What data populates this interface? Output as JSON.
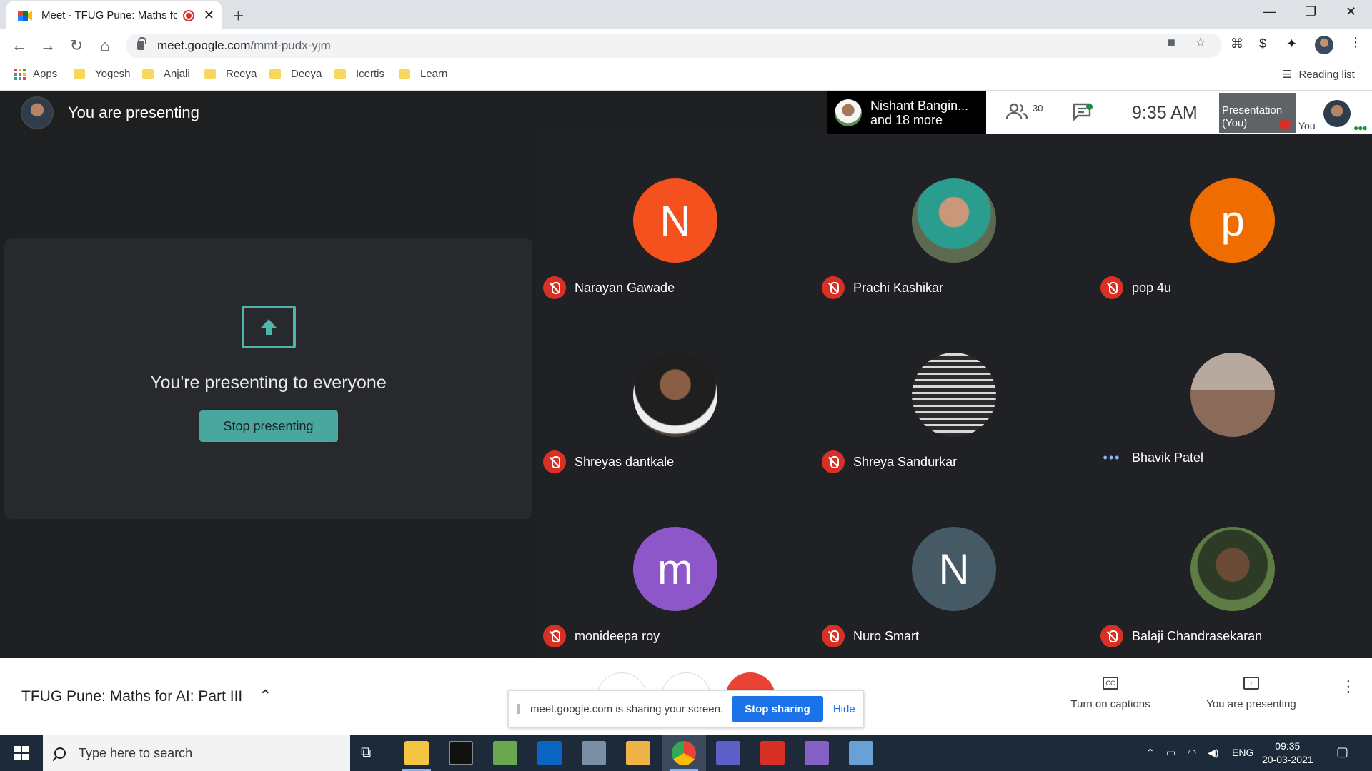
{
  "browser": {
    "tab_title": "Meet - TFUG Pune: Maths for AI: Part III",
    "url_host": "meet.google.com",
    "url_path": "/mmf-pudx-yjm",
    "new_tab_symbol": "+",
    "bookmarks": [
      {
        "label": "Apps",
        "icon": "apps-grid-icon"
      },
      {
        "label": "Yogesh",
        "icon": "folder-icon"
      },
      {
        "label": "Anjali",
        "icon": "folder-icon"
      },
      {
        "label": "Reeya",
        "icon": "folder-icon"
      },
      {
        "label": "Deeya",
        "icon": "folder-icon"
      },
      {
        "label": "Icertis",
        "icon": "folder-icon"
      },
      {
        "label": "Learn",
        "icon": "folder-icon"
      }
    ],
    "reading_list": "Reading list"
  },
  "meet": {
    "banner": "You are presenting",
    "presenting_card": {
      "message": "You're presenting to everyone",
      "stop_button": "Stop presenting"
    },
    "speaker_chip": {
      "line1": "Nishant Bangin...",
      "line2": "and 18 more"
    },
    "people_count": "30",
    "time": "9:35 AM",
    "presentation_thumb": {
      "line1": "Presentation",
      "line2": "(You)"
    },
    "you_label": "You",
    "participants": [
      {
        "name": "Narayan Gawade",
        "initial": "N",
        "color": "#f4511e",
        "status": "muted"
      },
      {
        "name": "Prachi Kashikar",
        "initial": "",
        "color": "#6b8f8a",
        "status": "muted"
      },
      {
        "name": "pop 4u",
        "initial": "p",
        "color": "#ef6c00",
        "status": "muted"
      },
      {
        "name": "Shreyas dantkale",
        "initial": "",
        "color": "#4a4039",
        "status": "muted"
      },
      {
        "name": "Shreya Sandurkar",
        "initial": "",
        "color": "#7b7b7b",
        "status": "muted"
      },
      {
        "name": "Bhavik Patel",
        "initial": "",
        "color": "#8a6b5a",
        "status": "more"
      },
      {
        "name": "monideepa roy",
        "initial": "m",
        "color": "#8e57c9",
        "status": "muted"
      },
      {
        "name": "Nuro Smart",
        "initial": "N",
        "color": "#455a64",
        "status": "muted"
      },
      {
        "name": "Balaji Chandrasekaran",
        "initial": "",
        "color": "#4e6b3c",
        "status": "muted"
      }
    ]
  },
  "bottom": {
    "meeting_title": "TFUG Pune: Maths for AI: Part III",
    "share_message": "meet.google.com is sharing your screen.",
    "stop_sharing": "Stop sharing",
    "hide": "Hide",
    "captions": "Turn on captions",
    "captions_icon_text": "CC",
    "you_are_presenting": "You are presenting"
  },
  "taskbar": {
    "search_placeholder": "Type here to search",
    "language": "ENG",
    "time": "09:35",
    "date": "20-03-2021"
  },
  "colors": {
    "accent_teal": "#49a79d",
    "mute_red": "#d93025",
    "google_blue": "#1a73e8"
  }
}
